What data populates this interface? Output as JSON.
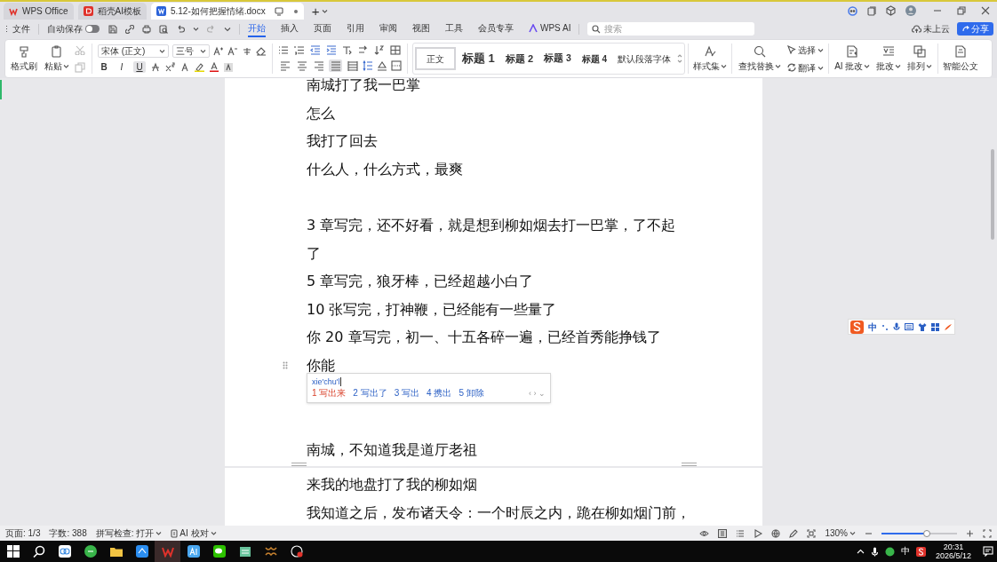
{
  "title_bar": {
    "tabs": [
      {
        "label": "WPS Office",
        "kind": "home",
        "selected": false
      },
      {
        "label": "稻壳AI模板",
        "kind": "docer",
        "selected": false
      },
      {
        "label": "5.12-如何把握情绪.docx",
        "kind": "doc",
        "selected": true
      }
    ],
    "new_tab": "+"
  },
  "menu_bar": {
    "file": "文件",
    "autosave": {
      "label": "自动保存",
      "on": false
    },
    "tabs": [
      {
        "label": "开始",
        "selected": true
      },
      {
        "label": "插入",
        "selected": false
      },
      {
        "label": "页面",
        "selected": false
      },
      {
        "label": "引用",
        "selected": false
      },
      {
        "label": "审阅",
        "selected": false
      },
      {
        "label": "视图",
        "selected": false
      },
      {
        "label": "工具",
        "selected": false
      },
      {
        "label": "会员专享",
        "selected": false
      },
      {
        "label": "WPS AI",
        "selected": false
      }
    ],
    "search": {
      "placeholder": "搜索"
    },
    "cloud": "未上云",
    "share": "分享"
  },
  "ribbon": {
    "format_painter": "格式刷",
    "paste": "粘贴",
    "font_name": "宋体 (正文)",
    "font_size": "三号",
    "format_buttons": [
      {
        "label": "B",
        "selected": false
      },
      {
        "label": "I",
        "selected": false
      },
      {
        "label": "U",
        "selected": true
      }
    ],
    "align_buttons": [
      {
        "selected": false
      },
      {
        "selected": false
      },
      {
        "selected": false
      },
      {
        "selected": true
      },
      {
        "selected": false
      }
    ],
    "styles": [
      {
        "label": "正文",
        "selected": true
      },
      {
        "label": "标题 1",
        "selected": false
      },
      {
        "label": "标题 2",
        "selected": false
      },
      {
        "label": "标题 3",
        "selected": false
      },
      {
        "label": "标题 4",
        "selected": false
      },
      {
        "label": "默认段落字体",
        "selected": false
      }
    ],
    "style_set": "样式集",
    "find_replace": "查找替换",
    "select": "选择",
    "translate": "翻译",
    "ai_review": "AI 批改",
    "review": "批改",
    "arrange": "排列",
    "smart_doc": "智能公文"
  },
  "document": {
    "pages": [
      {
        "paragraphs": [
          {
            "kind": "text",
            "text": "南城打了我一巴掌"
          },
          {
            "kind": "text",
            "text": "怎么"
          },
          {
            "kind": "text",
            "text": "我打了回去"
          },
          {
            "kind": "text",
            "text": "什么人，什么方式，最爽"
          },
          {
            "kind": "blank"
          },
          {
            "kind": "text",
            "text": "3 章写完，还不好看，就是想到柳如烟去打一巴掌，了不起了"
          },
          {
            "kind": "text",
            "text": "5 章写完，狼牙棒，已经超越小白了"
          },
          {
            "kind": "text",
            "text": "10 张写完，打神鞭，已经能有一些量了"
          },
          {
            "kind": "text",
            "text": "你 20 章写完，初一、十五各碎一遍，已经首秀能挣钱了"
          },
          {
            "kind": "text",
            "text": "你能",
            "drag_handle": true
          },
          {
            "kind": "blank"
          },
          {
            "kind": "blank"
          },
          {
            "kind": "text",
            "text": "南城，不知道我是道厅老祖"
          }
        ]
      },
      {
        "paragraphs": [
          {
            "kind": "text",
            "text": "来我的地盘打了我的柳如烟"
          },
          {
            "kind": "text",
            "text": "我知道之后，发布诸天令：一个时辰之内，跪在柳如烟门前，"
          }
        ]
      }
    ],
    "ime_popup": {
      "input": "xie'chu'l",
      "candidates": [
        {
          "index": "1",
          "text": "写出来",
          "selected": true
        },
        {
          "index": "2",
          "text": "写出了",
          "selected": false
        },
        {
          "index": "3",
          "text": "写出",
          "selected": false
        },
        {
          "index": "4",
          "text": "携出",
          "selected": false
        },
        {
          "index": "5",
          "text": "卸除",
          "selected": false
        }
      ],
      "nav": "‹ › ⌄"
    },
    "ime_toolbar": {
      "mode": "中"
    }
  },
  "status_bar": {
    "page": "页面: 1/3",
    "words": "字数: 388",
    "spell": "拼写检查: 打开",
    "ai_check": "AI 校对",
    "zoom": "130%",
    "zoom_slider": {
      "level": 0.6
    }
  },
  "taskbar": {
    "input_mode": "中",
    "time": "20:31",
    "date": "2026/5/12"
  }
}
